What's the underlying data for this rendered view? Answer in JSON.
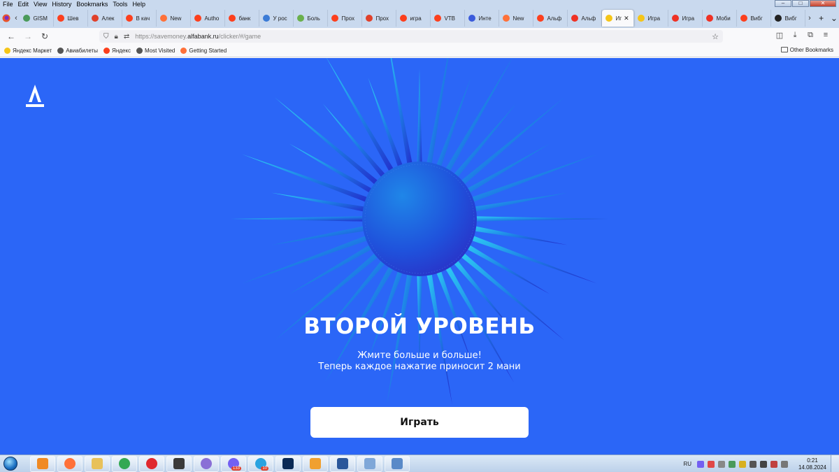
{
  "menu": [
    "File",
    "Edit",
    "View",
    "History",
    "Bookmarks",
    "Tools",
    "Help"
  ],
  "tabs": [
    {
      "label": "GISM",
      "color": "#4a9a5a"
    },
    {
      "label": "Шев",
      "color": "#fc3f1d"
    },
    {
      "label": "Алек",
      "color": "#e0402a"
    },
    {
      "label": "В кач",
      "color": "#fc3f1d"
    },
    {
      "label": "New",
      "color": "#ff7139"
    },
    {
      "label": "Autho",
      "color": "#fc3f1d"
    },
    {
      "label": "банк",
      "color": "#fc3f1d"
    },
    {
      "label": "У рос",
      "color": "#3b7bd6"
    },
    {
      "label": "Боль",
      "color": "#6ab04c"
    },
    {
      "label": "Прох",
      "color": "#fc3f1d"
    },
    {
      "label": "Прох",
      "color": "#e0402a"
    },
    {
      "label": "игра",
      "color": "#fc3f1d"
    },
    {
      "label": "VTB",
      "color": "#fc3f1d"
    },
    {
      "label": "Инте",
      "color": "#3b5bdb"
    },
    {
      "label": "New",
      "color": "#ff7139"
    },
    {
      "label": "Альф",
      "color": "#fc3f1d"
    },
    {
      "label": "Альф",
      "color": "#ef3124"
    },
    {
      "label": "Иг",
      "color": "#f5c518",
      "active": true
    },
    {
      "label": "Игра",
      "color": "#f5c518"
    },
    {
      "label": "Игра",
      "color": "#ef3124"
    },
    {
      "label": "Моби",
      "color": "#ef3124"
    },
    {
      "label": "Вибг",
      "color": "#fc3f1d"
    },
    {
      "label": "Вибг",
      "color": "#222222"
    }
  ],
  "url": {
    "prefix": "https://savemoney.",
    "domain": "alfabank.ru",
    "path": "/clicker/#/game"
  },
  "bookmarks": [
    {
      "label": "Яндекс Маркет",
      "color": "#f5c518"
    },
    {
      "label": "Авиабилеты",
      "color": "#555555"
    },
    {
      "label": "Яндекс",
      "color": "#fc3f1d"
    },
    {
      "label": "Most Visited",
      "color": "#555555"
    },
    {
      "label": "Getting Started",
      "color": "#ff7139"
    }
  ],
  "other_bookmarks": "Other Bookmarks",
  "game": {
    "title": "ВТОРОЙ УРОВЕНЬ",
    "subtitle_line1": "Жмите больше и больше!",
    "subtitle_line2": "Теперь каждое нажатие приносит 2 мани",
    "play_label": "Играть",
    "bg_color": "#2b66f7"
  },
  "taskbar": {
    "apps": [
      {
        "name": "media-player",
        "color": "#f08a24"
      },
      {
        "name": "firefox",
        "color": "#ff7139"
      },
      {
        "name": "explorer",
        "color": "#e8c15a"
      },
      {
        "name": "chrome",
        "color": "#34a853"
      },
      {
        "name": "opera",
        "color": "#e0282e"
      },
      {
        "name": "nox",
        "color": "#3a3a3a"
      },
      {
        "name": "app-globe",
        "color": "#8a6fd6"
      },
      {
        "name": "viber",
        "color": "#7360f2",
        "badge": "133"
      },
      {
        "name": "telegram",
        "color": "#2aa3e0",
        "badge": "10"
      },
      {
        "name": "photoshop",
        "color": "#0b2a55"
      },
      {
        "name": "app-pen",
        "color": "#f0a030"
      },
      {
        "name": "word",
        "color": "#2b579a"
      },
      {
        "name": "app-doc",
        "color": "#7fa7d8"
      },
      {
        "name": "app-window",
        "color": "#5a8ac8"
      }
    ],
    "lang": "RU",
    "time": "0:21",
    "date": "14.08.2024"
  }
}
